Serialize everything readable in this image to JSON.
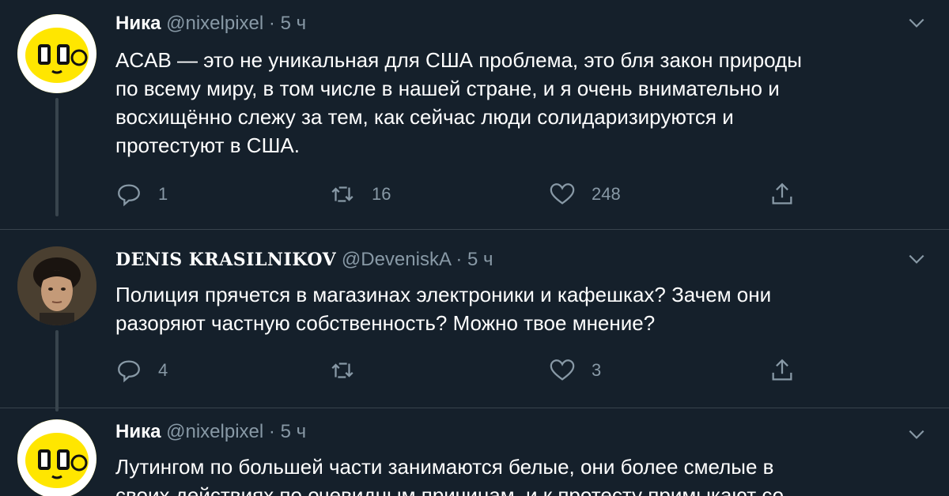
{
  "tweets": [
    {
      "name": "Ника",
      "handle": "@nixelpixel",
      "separator": "·",
      "time": "5 ч",
      "text": "ACAB — это не уникальная для США проблема, это бля закон природы\nпо всему миру, в том числе в нашей стране, и я очень внимательно и\nвосхищённо слежу за тем, как сейчас люди солидаризируются и\nпротестуют в США.",
      "replies": "1",
      "retweets": "16",
      "likes": "248"
    },
    {
      "name": "DENIS KRASILNIKOV",
      "handle": "@DeveniskA",
      "separator": "·",
      "time": "5 ч",
      "text": "Полиция прячется в магазинах электроники и кафешках? Зачем они\nразоряют частную собственность? Можно твое мнение?",
      "replies": "4",
      "retweets": "",
      "likes": "3"
    },
    {
      "name": "Ника",
      "handle": "@nixelpixel",
      "separator": "·",
      "time": "5 ч",
      "text": "Лутингом по большей части занимаются белые, они более смелые в\nсвоих действиях по очевидным причинам, и к протесту примыкают со"
    }
  ],
  "colors": {
    "background": "#15202b",
    "secondary_text": "#8899a6",
    "thread_line": "#38444d",
    "avatar_yellow": "#ffe600"
  },
  "icons": [
    "reply-icon",
    "retweet-icon",
    "like-icon",
    "share-icon",
    "chevron-down-icon"
  ]
}
